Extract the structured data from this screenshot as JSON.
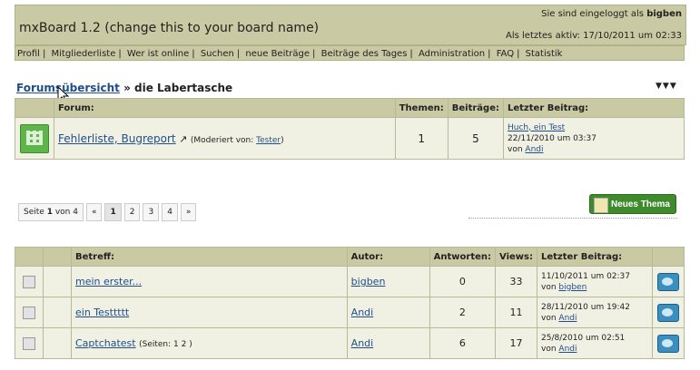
{
  "header": {
    "title": "mxBoard 1.2 (change this to your board name)",
    "login_text": "Sie sind eingeloggt als ",
    "login_user": "bigben",
    "last_active": "Als letztes aktiv: 17/10/2011 um 02:33"
  },
  "nav": [
    "Profil",
    "Mitgliederliste",
    "Wer ist online",
    "Suchen",
    "neue Beiträge",
    "Beiträge des Tages",
    "Administration",
    "FAQ",
    "Statistik"
  ],
  "breadcrumb": {
    "link": "Forumsübersicht",
    "current": " » die Labertasche",
    "arrows": "▼▼▼"
  },
  "forum_table": {
    "headers": {
      "forum": "Forum:",
      "topics": "Themen:",
      "posts": "Beiträge:",
      "last": "Letzter Beitrag:"
    },
    "row": {
      "name": "Fehlerliste, Bugreport",
      "moderated_prefix": "(Moderiert von: ",
      "moderator": "Tester",
      "moderated_suffix": ")",
      "topics": "1",
      "posts": "5",
      "last_title": "Huch, ein Test",
      "last_date": "22/11/2010 um 03:37",
      "last_by": "von ",
      "last_user": "Andi"
    }
  },
  "pager": {
    "label_prefix": "Seite ",
    "current": "1",
    "label_suffix": " von 4",
    "first": "«",
    "pages": [
      "1",
      "2",
      "3",
      "4"
    ],
    "next": "»"
  },
  "new_topic_button": "Neues Thema",
  "topics_table": {
    "headers": {
      "subject": "Betreff:",
      "author": "Autor:",
      "replies": "Antworten:",
      "views": "Views:",
      "last": "Letzter Beitrag:"
    },
    "rows": [
      {
        "subject": "mein erster...",
        "pages": "",
        "author": "bigben",
        "replies": "0",
        "views": "33",
        "date": "11/10/2011 um 02:37",
        "by": "bigben"
      },
      {
        "subject": "ein Testtttt",
        "pages": "",
        "author": "Andi",
        "replies": "2",
        "views": "11",
        "date": "28/11/2010 um 19:42",
        "by": "Andi"
      },
      {
        "subject": "Captchatest",
        "pages": "(Seiten: 1 2 )",
        "author": "Andi",
        "replies": "6",
        "views": "17",
        "date": "25/8/2010 um 02:51",
        "by": "Andi"
      }
    ],
    "by_prefix": "von "
  }
}
